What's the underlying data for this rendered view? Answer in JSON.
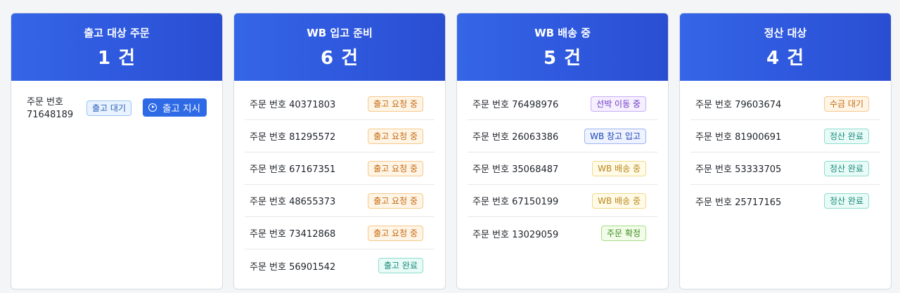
{
  "columns": [
    {
      "title": "출고 대상 주문",
      "count": "1 건",
      "pending": {
        "order_label": "주문 번호",
        "order_no": "71648189",
        "status": "출고 대기",
        "action_label": "출고 지시"
      }
    },
    {
      "title": "WB 입고 준비",
      "count": "6 건",
      "rows": [
        {
          "order": "주문 번호 40371803",
          "status": "출고 요청 중"
        },
        {
          "order": "주문 번호 81295572",
          "status": "출고 요청 중"
        },
        {
          "order": "주문 번호 67167351",
          "status": "출고 요청 중"
        },
        {
          "order": "주문 번호 48655373",
          "status": "출고 요청 중"
        },
        {
          "order": "주문 번호 73412868",
          "status": "출고 요청 중"
        },
        {
          "order": "주문 번호 56901542",
          "status": "출고 완료"
        }
      ]
    },
    {
      "title": "WB 배송 중",
      "count": "5 건",
      "rows": [
        {
          "order": "주문 번호 76498976",
          "status": "선박 이동 중"
        },
        {
          "order": "주문 번호 26063386",
          "status": "WB 창고 입고"
        },
        {
          "order": "주문 번호 35068487",
          "status": "WB 배송 중"
        },
        {
          "order": "주문 번호 67150199",
          "status": "WB 배송 중"
        },
        {
          "order": "주문 번호 13029059",
          "status": "주문 확정"
        }
      ]
    },
    {
      "title": "정산 대상",
      "count": "4 건",
      "rows": [
        {
          "order": "주문 번호 79603674",
          "status": "수금 대기"
        },
        {
          "order": "주문 번호 81900691",
          "status": "정산 완료"
        },
        {
          "order": "주문 번호 53333705",
          "status": "정산 완료"
        },
        {
          "order": "주문 번호 25717165",
          "status": "정산 완료"
        }
      ]
    }
  ],
  "colors": {
    "header_gradient_start": "#3566e6",
    "header_gradient_end": "#2a4ed2",
    "action_button": "#2f6ae6"
  },
  "icons": {
    "action_button_icon": "play-circle-icon"
  }
}
